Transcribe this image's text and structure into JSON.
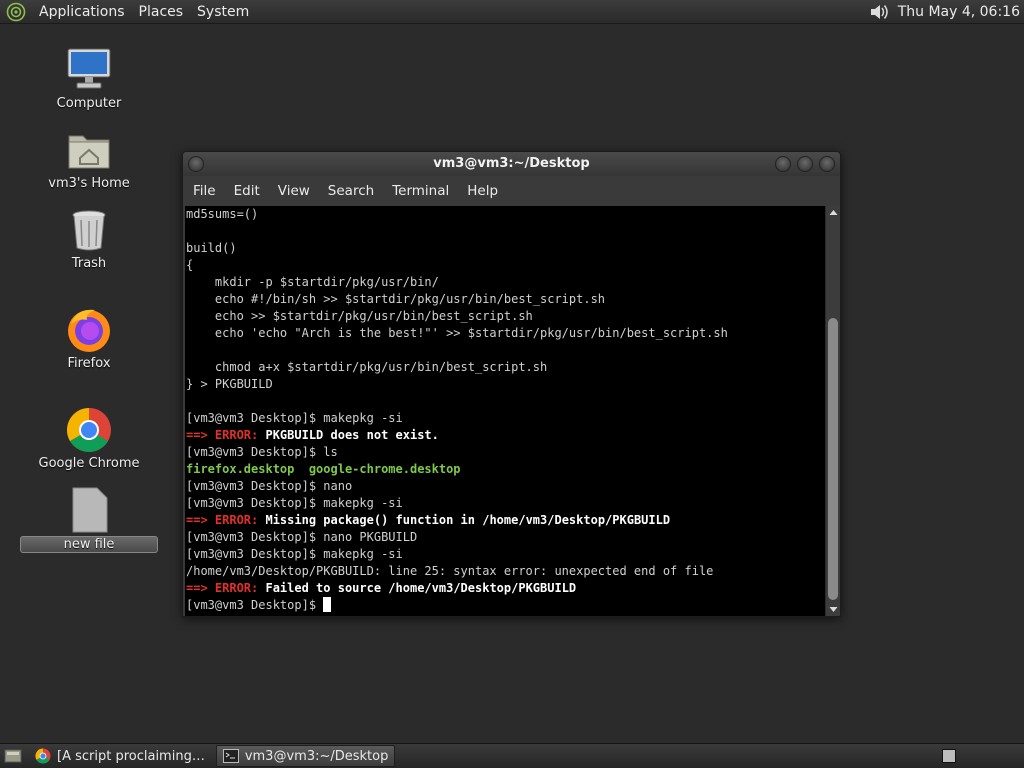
{
  "top_panel": {
    "menus": [
      "Applications",
      "Places",
      "System"
    ],
    "clock": "Thu May  4, 06:16"
  },
  "desktop_icons": [
    {
      "label": "Computer",
      "icon": "computer-icon"
    },
    {
      "label": "vm3's Home",
      "icon": "home-folder-icon"
    },
    {
      "label": "Trash",
      "icon": "trash-icon"
    },
    {
      "label": "Firefox",
      "icon": "firefox-icon"
    },
    {
      "label": "Google Chrome",
      "icon": "chrome-icon"
    },
    {
      "label": "new file",
      "icon": "file-icon"
    }
  ],
  "terminal": {
    "title": "vm3@vm3:~/Desktop",
    "menus": [
      "File",
      "Edit",
      "View",
      "Search",
      "Terminal",
      "Help"
    ],
    "lines": [
      [
        {
          "t": "md5sums=()"
        }
      ],
      [],
      [
        {
          "t": "build()"
        }
      ],
      [
        {
          "t": "{"
        }
      ],
      [
        {
          "t": "    mkdir -p $startdir/pkg/usr/bin/"
        }
      ],
      [
        {
          "t": "    echo #!/bin/sh >> $startdir/pkg/usr/bin/best_script.sh"
        }
      ],
      [
        {
          "t": "    echo >> $startdir/pkg/usr/bin/best_script.sh"
        }
      ],
      [
        {
          "t": "    echo 'echo \"Arch is the best!\"' >> $startdir/pkg/usr/bin/best_script.sh"
        }
      ],
      [],
      [
        {
          "t": "    chmod a+x $startdir/pkg/usr/bin/best_script.sh"
        }
      ],
      [
        {
          "t": "} > PKGBUILD"
        }
      ],
      [],
      [
        {
          "t": "[vm3@vm3 Desktop]$ makepkg -si"
        }
      ],
      [
        {
          "t": "==> ERROR: ",
          "s": "red"
        },
        {
          "t": "PKGBUILD does not exist.",
          "s": "bold"
        }
      ],
      [
        {
          "t": "[vm3@vm3 Desktop]$ ls"
        }
      ],
      [
        {
          "t": "firefox.desktop  google-chrome.desktop",
          "s": "green"
        }
      ],
      [
        {
          "t": "[vm3@vm3 Desktop]$ nano"
        }
      ],
      [
        {
          "t": "[vm3@vm3 Desktop]$ makepkg -si"
        }
      ],
      [
        {
          "t": "==> ERROR: ",
          "s": "red"
        },
        {
          "t": "Missing package() function in /home/vm3/Desktop/PKGBUILD",
          "s": "bold"
        }
      ],
      [
        {
          "t": "[vm3@vm3 Desktop]$ nano PKGBUILD"
        }
      ],
      [
        {
          "t": "[vm3@vm3 Desktop]$ makepkg -si"
        }
      ],
      [
        {
          "t": "/home/vm3/Desktop/PKGBUILD: line 25: syntax error: unexpected end of file"
        }
      ],
      [
        {
          "t": "==> ERROR: ",
          "s": "red"
        },
        {
          "t": "Failed to source /home/vm3/Desktop/PKGBUILD",
          "s": "bold"
        }
      ],
      [
        {
          "t": "[vm3@vm3 Desktop]$ "
        },
        {
          "t": "",
          "s": "cursor"
        }
      ]
    ]
  },
  "taskbar": {
    "tasks": [
      {
        "label": "[A script proclaiming…",
        "icon": "chrome-icon",
        "active": false
      },
      {
        "label": "vm3@vm3:~/Desktop",
        "icon": "terminal-icon",
        "active": true
      }
    ]
  }
}
